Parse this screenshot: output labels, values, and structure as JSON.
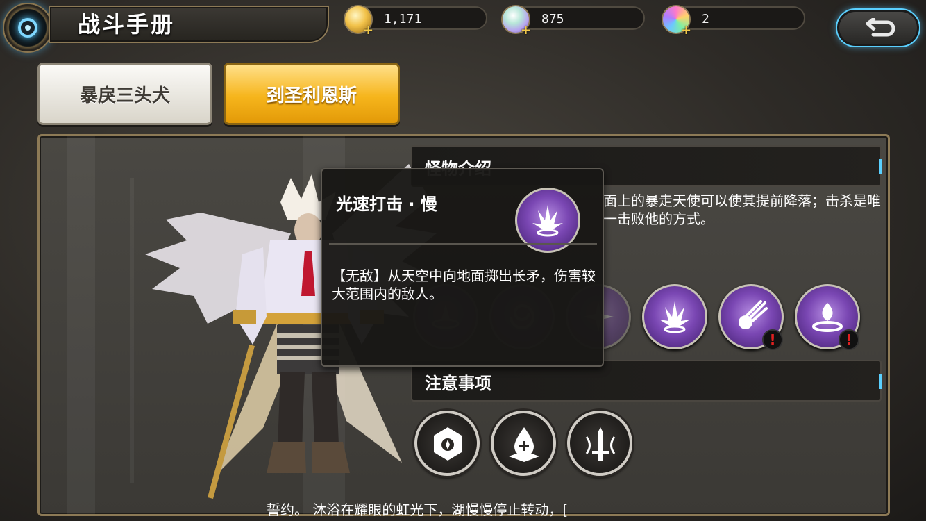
{
  "header": {
    "title": "战斗手册"
  },
  "currencies": [
    {
      "name": "gold",
      "icon": "gold-coin-icon",
      "value": "1,171",
      "color": "#f2c24a"
    },
    {
      "name": "crystal",
      "icon": "crystal-icon",
      "value": "875",
      "color": "#b7a3f0"
    },
    {
      "name": "rainbow-gem",
      "icon": "rainbow-gem-icon",
      "value": "2",
      "color": "#e56fd0"
    }
  ],
  "tabs": [
    {
      "label": "暴戾三头犬",
      "active": false
    },
    {
      "label": "刭圣利恩斯",
      "active": true
    }
  ],
  "sections": {
    "intro_title": "怪物介绍",
    "intro_text": "面上的暴走天使可以使其提前降落；击杀是唯一击败他的方式。",
    "notes_title": "注意事项"
  },
  "skills": [
    {
      "icon": "purple-aura-icon",
      "dim": true,
      "warning": false
    },
    {
      "icon": "spiral-icon",
      "dim": true,
      "warning": false
    },
    {
      "icon": "light-burst-icon",
      "dim": true,
      "warning": false
    },
    {
      "icon": "light-strike-icon",
      "dim": false,
      "warning": false
    },
    {
      "icon": "meteor-icon",
      "dim": false,
      "warning": true
    },
    {
      "icon": "flame-ring-icon",
      "dim": false,
      "warning": true
    }
  ],
  "warning_mark": "!",
  "notes": [
    {
      "icon": "shield-crest-icon"
    },
    {
      "icon": "healing-drop-icon"
    },
    {
      "icon": "sword-icon"
    }
  ],
  "tooltip": {
    "title": "光速打击 · 慢",
    "icon": "light-strike-icon",
    "description": "【无敌】从天空中向地面掷出长矛，伤害较大范围内的敌人。"
  },
  "ticker": {
    "text": "誓约。    沐浴在耀眼的虹光下，湖慢慢停止转动，["
  }
}
